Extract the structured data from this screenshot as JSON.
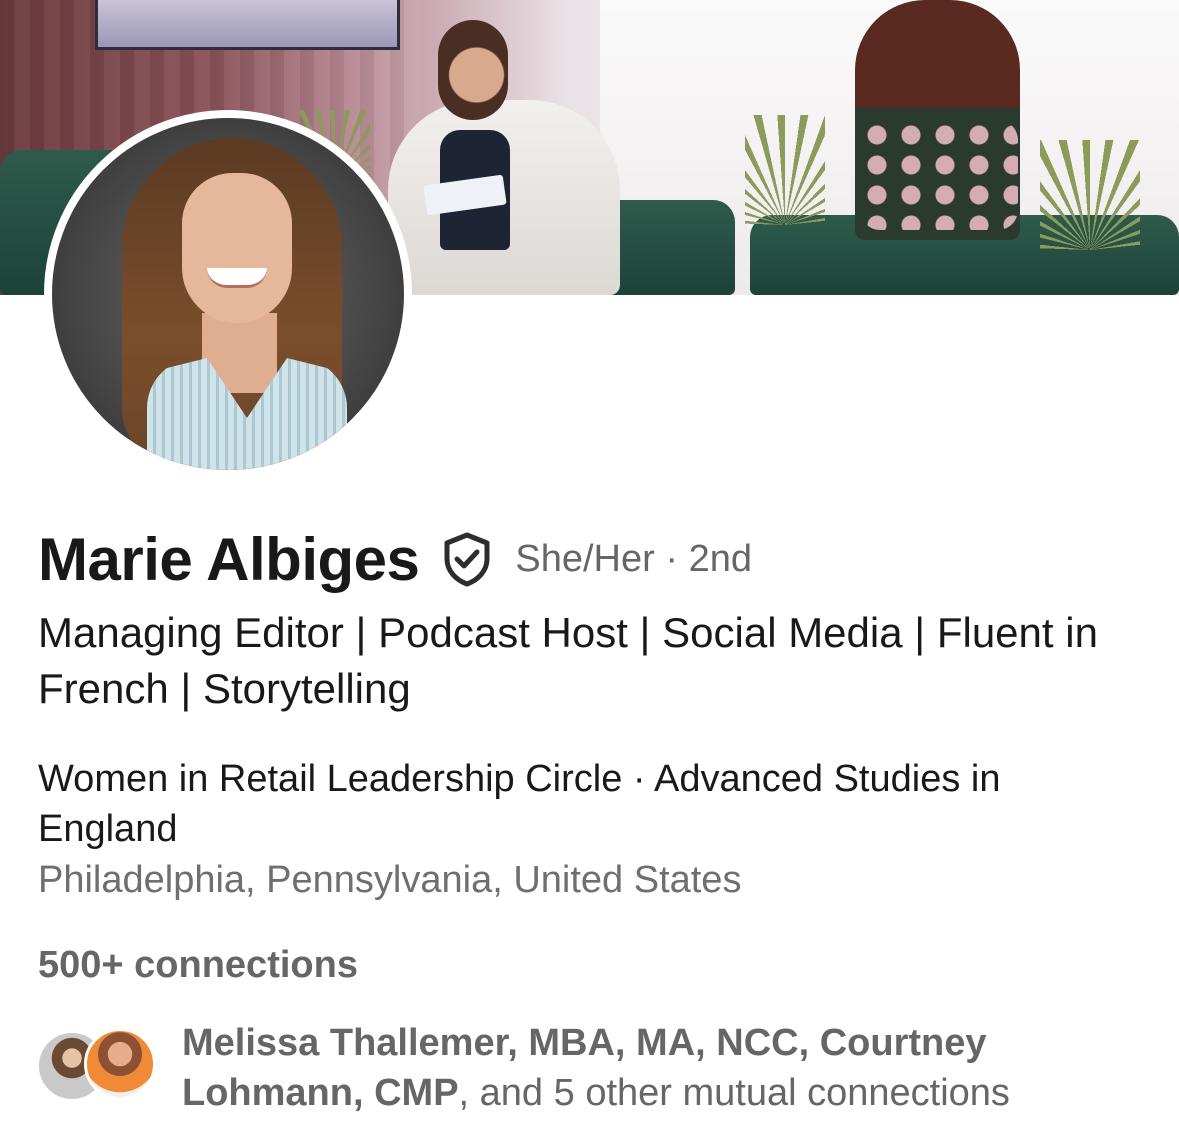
{
  "profile": {
    "name": "Marie Albiges",
    "pronouns": "She/Her",
    "separator": "·",
    "degree": "2nd",
    "headline": "Managing Editor | Podcast Host | Social Media | Fluent in French | Storytelling",
    "education": "Women in Retail Leadership Circle · Advanced Studies in England",
    "location": "Philadelphia, Pennsylvania, United States",
    "connections": "500+ connections"
  },
  "mutuals": {
    "names": "Melissa Thallemer, MBA, MA, NCC, Courtney Lohmann, CMP",
    "rest": ", and 5 other mutual connections"
  },
  "icons": {
    "verified": "shield-check-icon"
  },
  "colors": {
    "text_primary": "#191919",
    "text_secondary": "#666666"
  }
}
